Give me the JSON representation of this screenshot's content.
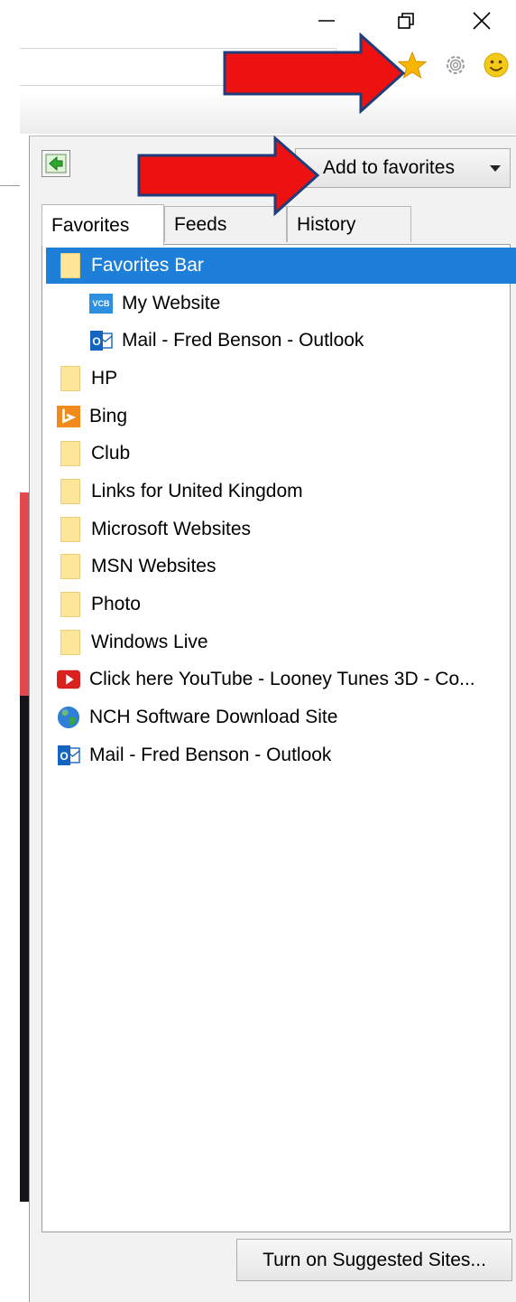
{
  "toolbar_icons": [
    {
      "name": "star-icon",
      "color": "#f7b500"
    },
    {
      "name": "gear-icon",
      "color": "#a0a0a0"
    },
    {
      "name": "smiley-icon",
      "color": "#f3c91a"
    }
  ],
  "panel": {
    "add_favorites_label": "Add to favorites",
    "tabs": [
      {
        "label": "Favorites",
        "active": true
      },
      {
        "label": "Feeds",
        "active": false
      },
      {
        "label": "History",
        "active": false
      }
    ],
    "items": [
      {
        "label": "Favorites Bar",
        "icon": "folder-icon",
        "selected": true
      },
      {
        "label": "My Website",
        "icon": "vcb-site-icon"
      },
      {
        "label": "Mail - Fred Benson - Outlook",
        "icon": "outlook-icon"
      },
      {
        "label": "HP",
        "icon": "folder-icon"
      },
      {
        "label": "Bing",
        "icon": "bing-icon"
      },
      {
        "label": "Club",
        "icon": "folder-icon"
      },
      {
        "label": "Links for United Kingdom",
        "icon": "folder-icon"
      },
      {
        "label": "Microsoft Websites",
        "icon": "folder-icon"
      },
      {
        "label": "MSN Websites",
        "icon": "folder-icon"
      },
      {
        "label": "Photo",
        "icon": "folder-icon"
      },
      {
        "label": "Windows Live",
        "icon": "folder-icon"
      },
      {
        "label": "Click here YouTube - Looney Tunes 3D - Co...",
        "icon": "youtube-icon"
      },
      {
        "label": "NCH Software Download Site",
        "icon": "globe-icon"
      },
      {
        "label": "Mail - Fred Benson - Outlook",
        "icon": "outlook-icon"
      }
    ],
    "suggested_sites_label": "Turn on Suggested Sites...",
    "vcb_icon_text": "VCB",
    "outlook_icon_text": "O"
  },
  "colors": {
    "selection": "#1e7fd9",
    "arrow_red": "#ee1111",
    "arrow_outline": "#1f3d7a"
  }
}
